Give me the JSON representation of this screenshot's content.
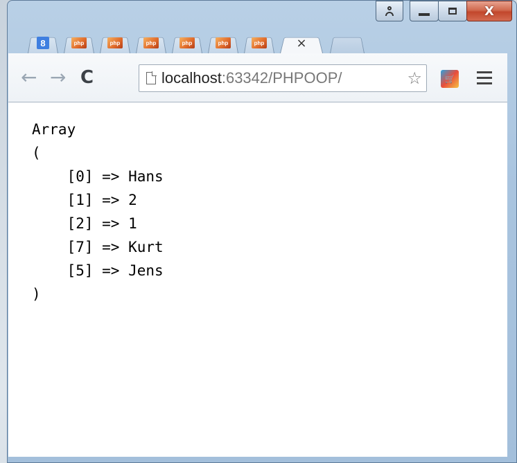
{
  "window": {
    "buttons": [
      "user",
      "minimize",
      "maximize",
      "close"
    ]
  },
  "tabs": [
    {
      "icon": "google-icon",
      "label": "8"
    },
    {
      "icon": "php-icon",
      "label": "php"
    },
    {
      "icon": "php-icon",
      "label": "php"
    },
    {
      "icon": "php-icon",
      "label": "php"
    },
    {
      "icon": "php-icon",
      "label": "php"
    },
    {
      "icon": "php-icon",
      "label": "php"
    },
    {
      "icon": "php-icon",
      "label": "php"
    }
  ],
  "active_tab_close": "×",
  "toolbar": {
    "url_host": "localhost",
    "url_rest": ":63342/PHPOOP/",
    "back": "←",
    "forward": "→",
    "reload": "C",
    "star": "☆"
  },
  "content": {
    "lines": [
      "Array",
      "(",
      "    [0] => Hans",
      "    [1] => 2",
      "    [2] => 1",
      "    [7] => Kurt",
      "    [5] => Jens",
      ")"
    ]
  },
  "colors": {
    "frame": "#a9c4df",
    "close_button": "#c2472c",
    "content_bg": "#ffffff"
  }
}
